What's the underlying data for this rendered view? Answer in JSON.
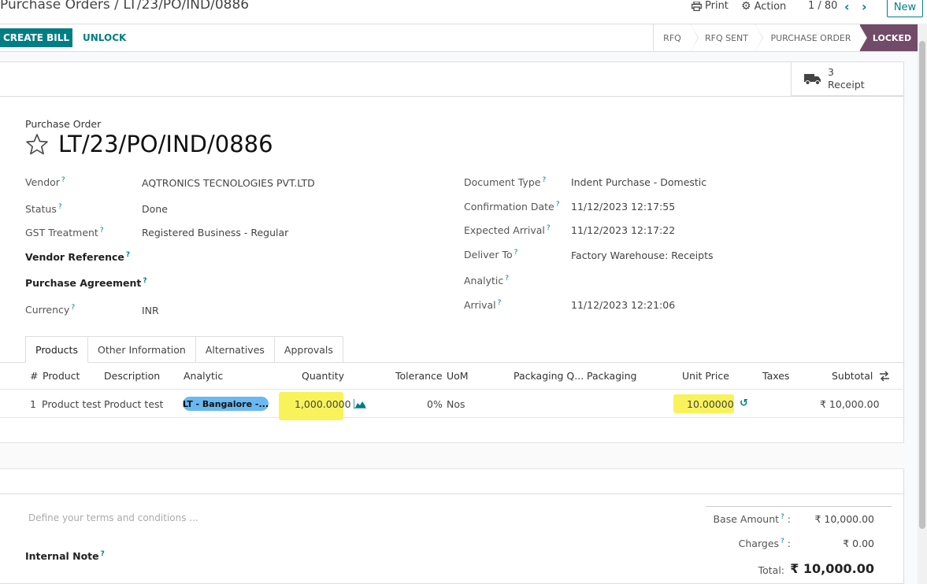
{
  "header": {
    "breadcrumb_parent": "Purchase Orders",
    "breadcrumb_sep": " / ",
    "breadcrumb_current": "LT/23/PO/IND/0886",
    "print_label": "Print",
    "action_label": "Action",
    "pager": "1 / 80",
    "new_label": "New"
  },
  "control": {
    "create_bill": "CREATE BILL",
    "unlock": "UNLOCK",
    "stages": [
      "RFQ",
      "RFQ SENT",
      "PURCHASE ORDER",
      "LOCKED"
    ],
    "active_stage": "LOCKED"
  },
  "smart_button": {
    "count": "3",
    "label": "Receipt"
  },
  "form": {
    "type_label": "Purchase Order",
    "name": "LT/23/PO/IND/0886",
    "left_fields": [
      {
        "label": "Vendor",
        "value": "AQTRONICS TECNOLOGIES PVT.LTD"
      },
      {
        "label": "Status",
        "value": "Done"
      },
      {
        "label": "GST Treatment",
        "value": "Registered Business - Regular"
      },
      {
        "label": "Vendor Reference",
        "value": ""
      },
      {
        "label": "Purchase Agreement",
        "value": ""
      },
      {
        "label": "Currency",
        "value": "INR"
      }
    ],
    "right_fields": [
      {
        "label": "Document Type",
        "value": "Indent Purchase - Domestic"
      },
      {
        "label": "Confirmation Date",
        "value": "11/12/2023 12:17:55"
      },
      {
        "label": "Expected Arrival",
        "value": "11/12/2023 12:17:22"
      },
      {
        "label": "Deliver To",
        "value": "Factory Warehouse: Receipts"
      },
      {
        "label": "Analytic",
        "value": ""
      },
      {
        "label": "Arrival",
        "value": "11/12/2023 12:21:06"
      }
    ]
  },
  "tabs": [
    "Products",
    "Other Information",
    "Alternatives",
    "Approvals"
  ],
  "table": {
    "columns": [
      "#",
      "Product",
      "Description",
      "Analytic",
      "Quantity",
      "Tolerance",
      "UoM",
      "Packaging Q...",
      "Packaging",
      "Unit Price",
      "Taxes",
      "Subtotal"
    ],
    "row": {
      "num": "1",
      "product": "Product test",
      "description": "Product test",
      "analytic": "LT - Bangalore -...",
      "quantity": "1,000.0000",
      "tolerance": "0%",
      "uom": "Nos",
      "unit_price": "10.00000",
      "subtotal": "₹ 10,000.00"
    }
  },
  "notes": {
    "terms_placeholder": "Define your terms and conditions ...",
    "internal_note_label": "Internal Note"
  },
  "totals": {
    "base_label": "Base Amount",
    "base_value": "₹ 10,000.00",
    "charges_label": "Charges",
    "charges_value": "₹ 0.00",
    "total_label": "Total:",
    "total_value": "₹ 10,000.00"
  },
  "colors": {
    "accent": "#017e84",
    "active_stage": "#714b67",
    "highlight": "#f8f35a",
    "tag": "#6ab8f0"
  }
}
